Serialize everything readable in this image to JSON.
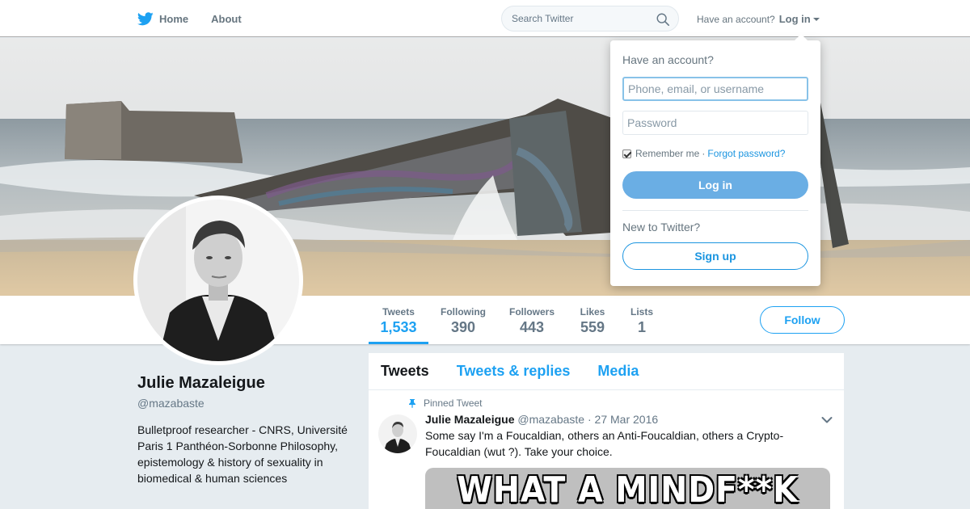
{
  "nav": {
    "home_label": "Home",
    "about_label": "About",
    "search_placeholder": "Search Twitter",
    "have_account": "Have an account?",
    "login_label": "Log in"
  },
  "login_dropdown": {
    "title": "Have an account?",
    "username_placeholder": "Phone, email, or username",
    "password_placeholder": "Password",
    "remember_label": "Remember me",
    "separator": "·",
    "forgot_label": "Forgot password?",
    "login_button": "Log in",
    "new_prompt": "New to Twitter?",
    "signup_button": "Sign up"
  },
  "stats": [
    {
      "label": "Tweets",
      "value": "1,533"
    },
    {
      "label": "Following",
      "value": "390"
    },
    {
      "label": "Followers",
      "value": "443"
    },
    {
      "label": "Likes",
      "value": "559"
    },
    {
      "label": "Lists",
      "value": "1"
    }
  ],
  "follow_button": "Follow",
  "profile": {
    "name": "Julie Mazaleigue",
    "handle": "@mazabaste",
    "bio": "Bulletproof researcher - CNRS, Université Paris 1 Panthéon-Sorbonne Philosophy, epistemology & history of sexuality in biomedical & human sciences"
  },
  "timeline": {
    "tabs": [
      "Tweets",
      "Tweets & replies",
      "Media"
    ],
    "pinned_label": "Pinned Tweet",
    "tweet": {
      "name": "Julie Mazaleigue",
      "handle": "@mazabaste",
      "separator": "·",
      "date": "27 Mar 2016",
      "text": "Some say I'm a Foucaldian, others an Anti-Foucaldian, others a Crypto-Foucaldian (wut ?). Take your choice.",
      "media_caption": "WHAT A MINDF**K"
    }
  },
  "colors": {
    "accent": "#1da1f2",
    "link": "#1b95e0",
    "login_button_bg": "#6aaee4",
    "page_bg": "#e6ecf0"
  },
  "icons": {
    "logo": "twitter-bird-icon",
    "search": "search-icon",
    "pin": "pin-icon",
    "menu": "chevron-down-icon"
  }
}
